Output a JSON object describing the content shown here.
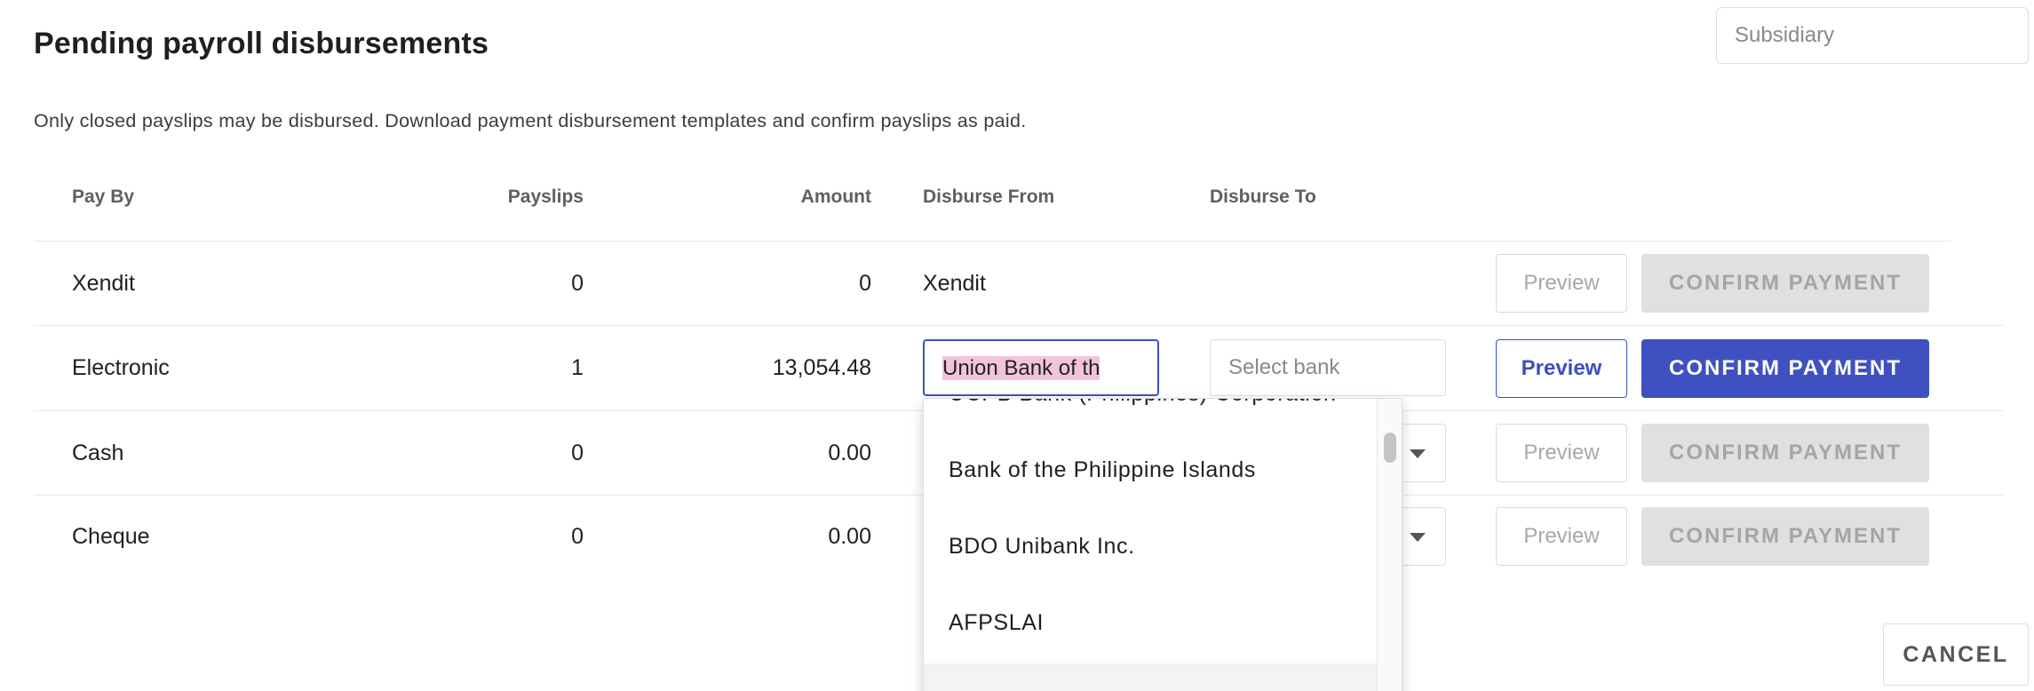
{
  "page": {
    "title": "Pending payroll disbursements",
    "subsidiary_placeholder": "Subsidiary",
    "subtitle": "Only closed payslips may be disbursed. Download payment disbursement templates and confirm payslips as paid."
  },
  "table": {
    "headers": {
      "pay_by": "Pay By",
      "payslips": "Payslips",
      "amount": "Amount",
      "disburse_from": "Disburse From",
      "disburse_to": "Disburse To"
    },
    "rows": [
      {
        "pay_by": "Xendit",
        "payslips": "0",
        "amount": "0",
        "disburse_from": "Xendit",
        "preview": "Preview",
        "confirm": "CONFIRM PAYMENT"
      },
      {
        "pay_by": "Electronic",
        "payslips": "1",
        "amount": "13,054.48",
        "disburse_from": "Union Bank of th",
        "disburse_to_placeholder": "Select bank",
        "preview": "Preview",
        "confirm": "CONFIRM PAYMENT"
      },
      {
        "pay_by": "Cash",
        "payslips": "0",
        "amount": "0.00",
        "preview": "Preview",
        "confirm": "CONFIRM PAYMENT"
      },
      {
        "pay_by": "Cheque",
        "payslips": "0",
        "amount": "0.00",
        "preview": "Preview",
        "confirm": "CONFIRM PAYMENT"
      }
    ]
  },
  "dropdown": {
    "options": [
      "UCPB Bank (Philippines) Corporation",
      "Bank of the Philippine Islands",
      "BDO Unibank Inc.",
      "AFPSLAI"
    ]
  },
  "footer": {
    "cancel": "CANCEL"
  },
  "colors": {
    "primary": "#3f51c1",
    "disabled_bg": "#e0e0e0",
    "disabled_text": "#a5a5a5",
    "highlight": "#f2c4dc"
  }
}
